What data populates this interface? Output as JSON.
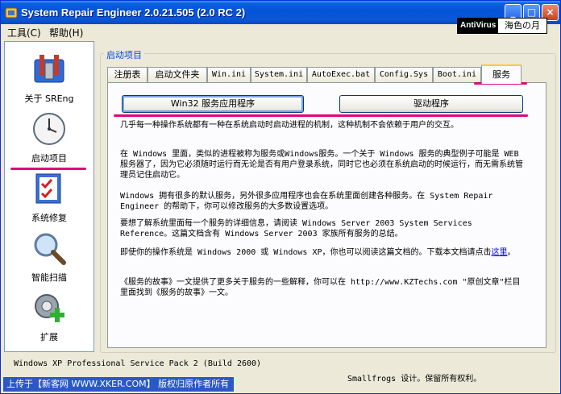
{
  "window": {
    "title": "System Repair Engineer 2.0.21.505 (2.0 RC 2)",
    "minimize_glyph": "_",
    "maximize_glyph": "□",
    "close_glyph": "×"
  },
  "menu": {
    "tools": "工具(C)",
    "help": "帮助(H)"
  },
  "badges": {
    "antivirus": "AntiVirus",
    "ocean": "海色の月"
  },
  "sidebar": {
    "items": [
      {
        "label": "关于 SREng",
        "icon": "toolbox-icon"
      },
      {
        "label": "启动项目",
        "icon": "clock-icon"
      },
      {
        "label": "系统修复",
        "icon": "checklist-icon"
      },
      {
        "label": "智能扫描",
        "icon": "magnifier-icon"
      },
      {
        "label": "扩展",
        "icon": "gear-plus-icon"
      }
    ]
  },
  "group": {
    "label": "启动项目"
  },
  "tabs": [
    {
      "label": "注册表"
    },
    {
      "label": "启动文件夹"
    },
    {
      "label": "Win.ini"
    },
    {
      "label": "System.ini"
    },
    {
      "label": "AutoExec.bat"
    },
    {
      "label": "Config.Sys"
    },
    {
      "label": "Boot.ini"
    },
    {
      "label": "服务"
    }
  ],
  "panel": {
    "btn_win32": "Win32 服务应用程序",
    "btn_driver": "驱动程序",
    "para1": "几乎每一种操作系统都有一种在系统启动时启动进程的机制，这种机制不会依赖于用户的交互。",
    "para2": "在 Windows 里面，类似的进程被称为服务或Windows服务。一个关于 Windows 服务的典型例子可能是 WEB 服务器了，因为它必须随时运行而无论是否有用户登录系统，同时它也必须在系统启动的时候运行，而无需系统管理员记住启动它。",
    "para3": "Windows 拥有很多的默认服务，另外很多应用程序也会在系统里面创建各种服务。在 System Repair Engineer 的帮助下，你可以修改服务的大多数设置选项。",
    "para4": "要想了解系统里面每一个服务的详细信息，请阅读 Windows Server 2003 System Services Reference。这篇文档含有 Windows Server 2003 家族所有服务的总结。",
    "para5_pre": "即使你的操作系统是 Windows 2000 或 Windows XP，你也可以阅读这篇文档的。下载本文档请点击",
    "para5_link": "这里",
    "para5_post": "。",
    "para6": "《服务的故事》一文提供了更多关于服务的一些解释，你可以在 http://www.KZTechs.com \"原创文章\"栏目里面找到《服务的故事》一文。"
  },
  "status": {
    "os": "Windows XP Professional Service Pack 2 (Build 2600)",
    "uploader": "上传于【新客网 WWW.XKER.COM】 版权归原作者所有",
    "copyright": "Smallfrogs 设计。保留所有权利。"
  },
  "colors": {
    "titlebar": "#0454d8",
    "annotation": "#e0067a",
    "link": "#0000ff",
    "group_label": "#0046d5"
  }
}
